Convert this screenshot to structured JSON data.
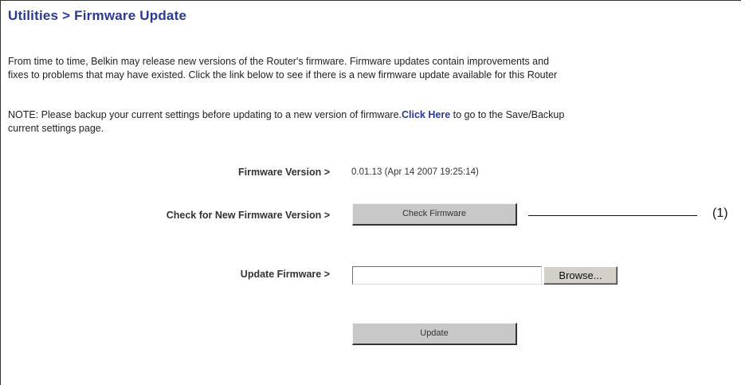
{
  "page": {
    "title": "Utilities > Firmware Update",
    "intro_line1": "From time to time, Belkin may release new versions of the Router's firmware. Firmware updates contain improvements and",
    "intro_line2": "fixes to problems that may have existed. Click the link below to see if there is a new firmware update available for this Router",
    "note_prefix": "NOTE: Please backup your current settings before updating to a new version of firmware.",
    "note_link": "Click Here",
    "note_suffix": " to go to the Save/Backup",
    "note_line2": "current settings page."
  },
  "firmware": {
    "version_label": "Firmware Version >",
    "version_value": "0.01.13 (Apr 14 2007 19:25:14)",
    "check_label": "Check for New Firmware Version >",
    "check_button": "Check Firmware",
    "update_label": "Update Firmware >",
    "file_value": "",
    "browse_button": "Browse...",
    "update_button": "Update"
  },
  "callout": {
    "label": "(1)"
  },
  "colors": {
    "title": "#2b3a8f",
    "link": "#2b3a8f",
    "button_face": "#c8c8c8"
  }
}
